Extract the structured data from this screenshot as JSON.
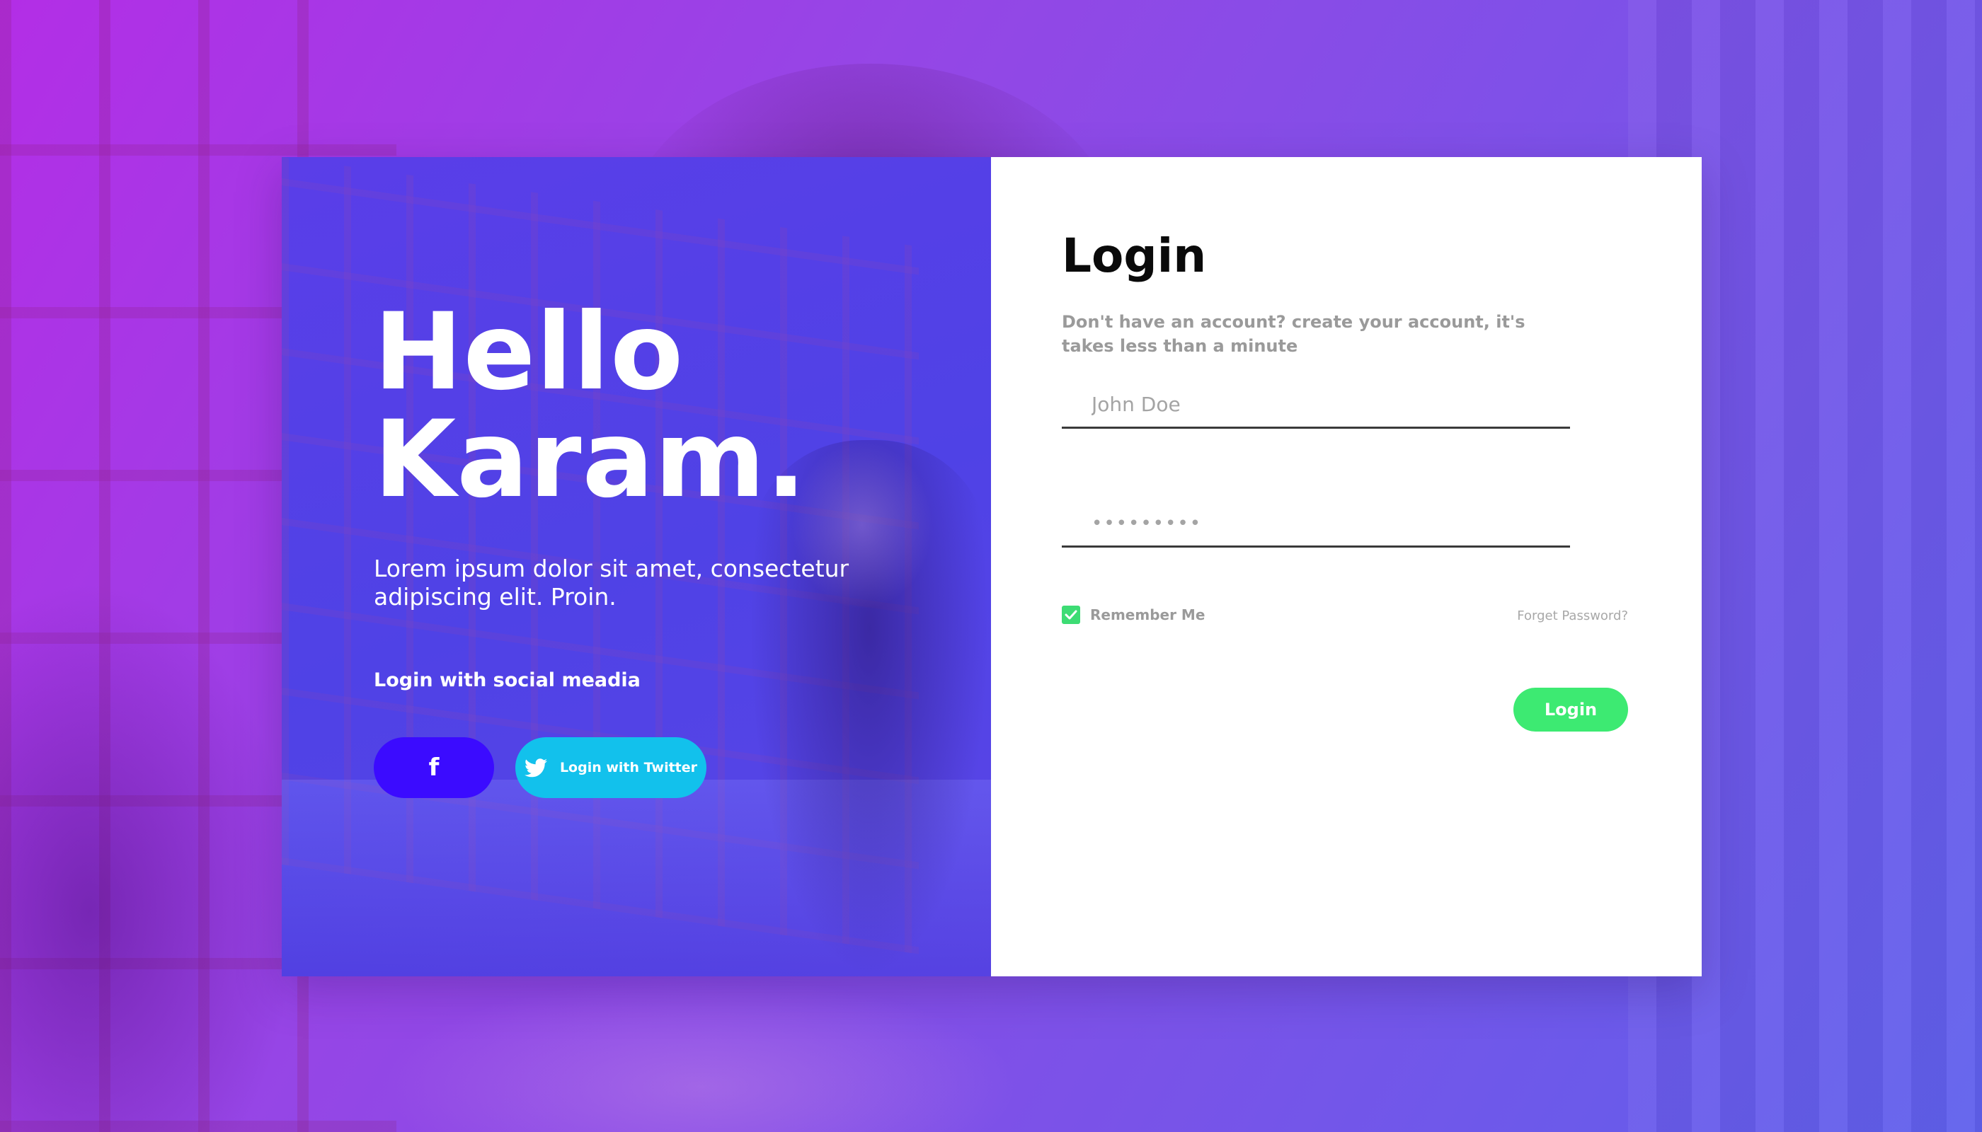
{
  "colors": {
    "background_start": "#b32ee6",
    "background_end": "#5f60ec",
    "left_panel": "#4f42e6",
    "facebook_button": "#3b0bff",
    "twitter_button": "#12c1ec",
    "login_button": "#3dea72",
    "checkbox": "#3ddc74"
  },
  "welcome": {
    "line1": "Hello",
    "line2": "Karam.",
    "lead": "Lorem ipsum dolor sit amet, consectetur adipiscing elit. Proin.",
    "social_title": "Login with social meadia",
    "facebook_icon": "f",
    "twitter_label": "Login with Twitter"
  },
  "icons": {
    "facebook": "facebook-icon",
    "twitter": "twitter-icon",
    "checkbox": "check-icon"
  },
  "form": {
    "title": "Login",
    "subtitle": "Don't have an account? create your account, it's takes less than a minute",
    "username_placeholder": "John Doe",
    "password_value": "•••••••••",
    "remember_label": "Remember Me",
    "remember_checked": true,
    "forgot_label": "Forget Password?",
    "submit_label": "Login"
  }
}
